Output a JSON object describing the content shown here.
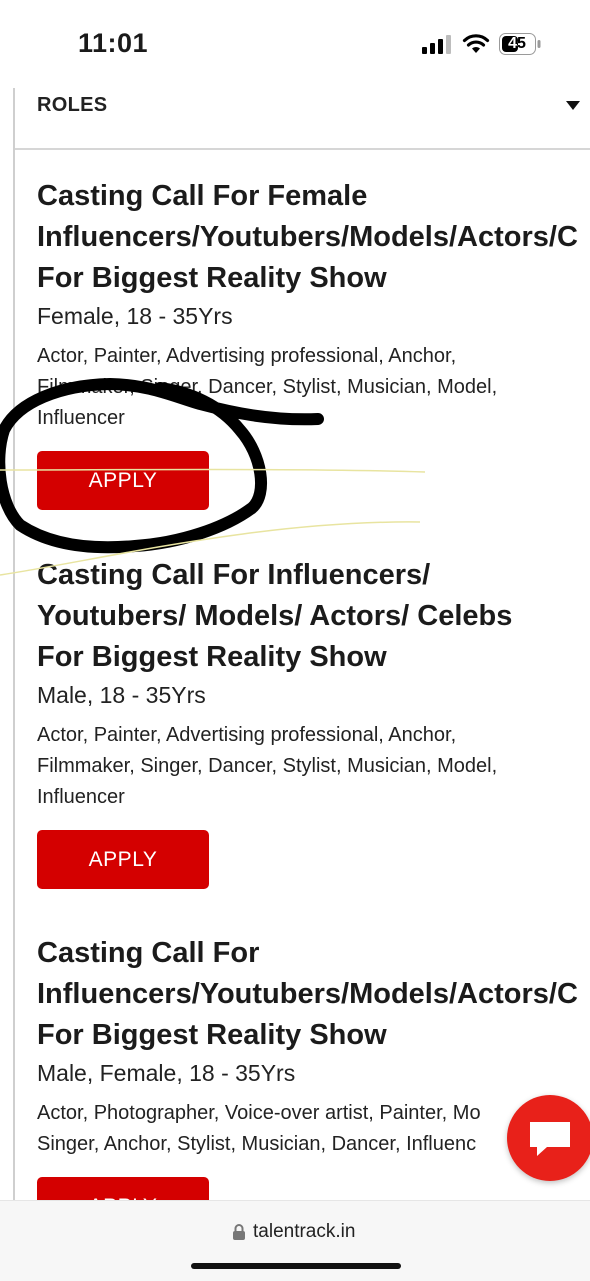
{
  "status_bar": {
    "time": "11:01",
    "battery": "45"
  },
  "filter": {
    "roles_label": "ROLES"
  },
  "listings": [
    {
      "title": "Casting Call For Female\nInfluencers/Youtubers/Models/Actors/C\nFor Biggest Reality Show",
      "meta": "Female, 18 - 35Yrs",
      "skills": "Actor, Painter, Advertising professional, Anchor,\nFilmmaker, Singer, Dancer, Stylist, Musician, Model,\nInfluencer",
      "apply_label": "APPLY"
    },
    {
      "title": "Casting Call For Influencers/\nYoutubers/ Models/ Actors/ Celebs\nFor Biggest Reality Show",
      "meta": "Male, 18 - 35Yrs",
      "skills": "Actor, Painter, Advertising professional, Anchor,\nFilmmaker, Singer, Dancer, Stylist, Musician, Model,\nInfluencer",
      "apply_label": "APPLY"
    },
    {
      "title": "Casting Call For\nInfluencers/Youtubers/Models/Actors/C\nFor Biggest Reality Show",
      "meta": "Male, Female, 18 - 35Yrs",
      "skills": "Actor, Photographer, Voice-over artist, Painter, Mo\nSinger, Anchor, Stylist, Musician, Dancer, Influenc",
      "apply_label": "APPLY"
    }
  ],
  "browser": {
    "url": "talentrack.in"
  },
  "colors": {
    "accent": "#d40000",
    "chat_button": "#e8211a"
  },
  "icons": [
    "signal-icon",
    "wifi-icon",
    "battery-icon",
    "chevron-down-icon",
    "chat-icon",
    "lock-icon"
  ]
}
